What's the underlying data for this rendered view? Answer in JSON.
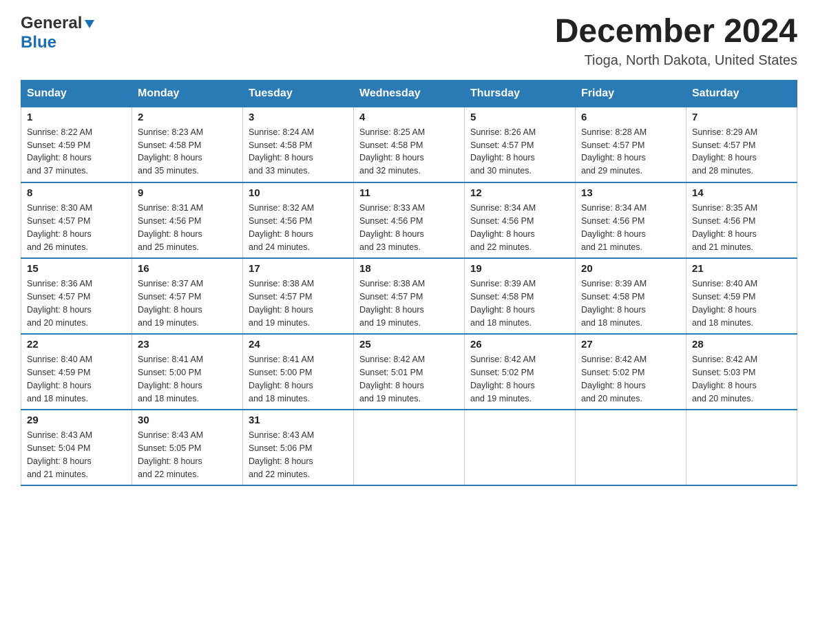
{
  "logo": {
    "general": "General",
    "blue": "Blue"
  },
  "title": "December 2024",
  "subtitle": "Tioga, North Dakota, United States",
  "days_of_week": [
    "Sunday",
    "Monday",
    "Tuesday",
    "Wednesday",
    "Thursday",
    "Friday",
    "Saturday"
  ],
  "weeks": [
    [
      {
        "day": "1",
        "sunrise": "Sunrise: 8:22 AM",
        "sunset": "Sunset: 4:59 PM",
        "daylight": "Daylight: 8 hours",
        "minutes": "and 37 minutes."
      },
      {
        "day": "2",
        "sunrise": "Sunrise: 8:23 AM",
        "sunset": "Sunset: 4:58 PM",
        "daylight": "Daylight: 8 hours",
        "minutes": "and 35 minutes."
      },
      {
        "day": "3",
        "sunrise": "Sunrise: 8:24 AM",
        "sunset": "Sunset: 4:58 PM",
        "daylight": "Daylight: 8 hours",
        "minutes": "and 33 minutes."
      },
      {
        "day": "4",
        "sunrise": "Sunrise: 8:25 AM",
        "sunset": "Sunset: 4:58 PM",
        "daylight": "Daylight: 8 hours",
        "minutes": "and 32 minutes."
      },
      {
        "day": "5",
        "sunrise": "Sunrise: 8:26 AM",
        "sunset": "Sunset: 4:57 PM",
        "daylight": "Daylight: 8 hours",
        "minutes": "and 30 minutes."
      },
      {
        "day": "6",
        "sunrise": "Sunrise: 8:28 AM",
        "sunset": "Sunset: 4:57 PM",
        "daylight": "Daylight: 8 hours",
        "minutes": "and 29 minutes."
      },
      {
        "day": "7",
        "sunrise": "Sunrise: 8:29 AM",
        "sunset": "Sunset: 4:57 PM",
        "daylight": "Daylight: 8 hours",
        "minutes": "and 28 minutes."
      }
    ],
    [
      {
        "day": "8",
        "sunrise": "Sunrise: 8:30 AM",
        "sunset": "Sunset: 4:57 PM",
        "daylight": "Daylight: 8 hours",
        "minutes": "and 26 minutes."
      },
      {
        "day": "9",
        "sunrise": "Sunrise: 8:31 AM",
        "sunset": "Sunset: 4:56 PM",
        "daylight": "Daylight: 8 hours",
        "minutes": "and 25 minutes."
      },
      {
        "day": "10",
        "sunrise": "Sunrise: 8:32 AM",
        "sunset": "Sunset: 4:56 PM",
        "daylight": "Daylight: 8 hours",
        "minutes": "and 24 minutes."
      },
      {
        "day": "11",
        "sunrise": "Sunrise: 8:33 AM",
        "sunset": "Sunset: 4:56 PM",
        "daylight": "Daylight: 8 hours",
        "minutes": "and 23 minutes."
      },
      {
        "day": "12",
        "sunrise": "Sunrise: 8:34 AM",
        "sunset": "Sunset: 4:56 PM",
        "daylight": "Daylight: 8 hours",
        "minutes": "and 22 minutes."
      },
      {
        "day": "13",
        "sunrise": "Sunrise: 8:34 AM",
        "sunset": "Sunset: 4:56 PM",
        "daylight": "Daylight: 8 hours",
        "minutes": "and 21 minutes."
      },
      {
        "day": "14",
        "sunrise": "Sunrise: 8:35 AM",
        "sunset": "Sunset: 4:56 PM",
        "daylight": "Daylight: 8 hours",
        "minutes": "and 21 minutes."
      }
    ],
    [
      {
        "day": "15",
        "sunrise": "Sunrise: 8:36 AM",
        "sunset": "Sunset: 4:57 PM",
        "daylight": "Daylight: 8 hours",
        "minutes": "and 20 minutes."
      },
      {
        "day": "16",
        "sunrise": "Sunrise: 8:37 AM",
        "sunset": "Sunset: 4:57 PM",
        "daylight": "Daylight: 8 hours",
        "minutes": "and 19 minutes."
      },
      {
        "day": "17",
        "sunrise": "Sunrise: 8:38 AM",
        "sunset": "Sunset: 4:57 PM",
        "daylight": "Daylight: 8 hours",
        "minutes": "and 19 minutes."
      },
      {
        "day": "18",
        "sunrise": "Sunrise: 8:38 AM",
        "sunset": "Sunset: 4:57 PM",
        "daylight": "Daylight: 8 hours",
        "minutes": "and 19 minutes."
      },
      {
        "day": "19",
        "sunrise": "Sunrise: 8:39 AM",
        "sunset": "Sunset: 4:58 PM",
        "daylight": "Daylight: 8 hours",
        "minutes": "and 18 minutes."
      },
      {
        "day": "20",
        "sunrise": "Sunrise: 8:39 AM",
        "sunset": "Sunset: 4:58 PM",
        "daylight": "Daylight: 8 hours",
        "minutes": "and 18 minutes."
      },
      {
        "day": "21",
        "sunrise": "Sunrise: 8:40 AM",
        "sunset": "Sunset: 4:59 PM",
        "daylight": "Daylight: 8 hours",
        "minutes": "and 18 minutes."
      }
    ],
    [
      {
        "day": "22",
        "sunrise": "Sunrise: 8:40 AM",
        "sunset": "Sunset: 4:59 PM",
        "daylight": "Daylight: 8 hours",
        "minutes": "and 18 minutes."
      },
      {
        "day": "23",
        "sunrise": "Sunrise: 8:41 AM",
        "sunset": "Sunset: 5:00 PM",
        "daylight": "Daylight: 8 hours",
        "minutes": "and 18 minutes."
      },
      {
        "day": "24",
        "sunrise": "Sunrise: 8:41 AM",
        "sunset": "Sunset: 5:00 PM",
        "daylight": "Daylight: 8 hours",
        "minutes": "and 18 minutes."
      },
      {
        "day": "25",
        "sunrise": "Sunrise: 8:42 AM",
        "sunset": "Sunset: 5:01 PM",
        "daylight": "Daylight: 8 hours",
        "minutes": "and 19 minutes."
      },
      {
        "day": "26",
        "sunrise": "Sunrise: 8:42 AM",
        "sunset": "Sunset: 5:02 PM",
        "daylight": "Daylight: 8 hours",
        "minutes": "and 19 minutes."
      },
      {
        "day": "27",
        "sunrise": "Sunrise: 8:42 AM",
        "sunset": "Sunset: 5:02 PM",
        "daylight": "Daylight: 8 hours",
        "minutes": "and 20 minutes."
      },
      {
        "day": "28",
        "sunrise": "Sunrise: 8:42 AM",
        "sunset": "Sunset: 5:03 PM",
        "daylight": "Daylight: 8 hours",
        "minutes": "and 20 minutes."
      }
    ],
    [
      {
        "day": "29",
        "sunrise": "Sunrise: 8:43 AM",
        "sunset": "Sunset: 5:04 PM",
        "daylight": "Daylight: 8 hours",
        "minutes": "and 21 minutes."
      },
      {
        "day": "30",
        "sunrise": "Sunrise: 8:43 AM",
        "sunset": "Sunset: 5:05 PM",
        "daylight": "Daylight: 8 hours",
        "minutes": "and 22 minutes."
      },
      {
        "day": "31",
        "sunrise": "Sunrise: 8:43 AM",
        "sunset": "Sunset: 5:06 PM",
        "daylight": "Daylight: 8 hours",
        "minutes": "and 22 minutes."
      },
      null,
      null,
      null,
      null
    ]
  ]
}
